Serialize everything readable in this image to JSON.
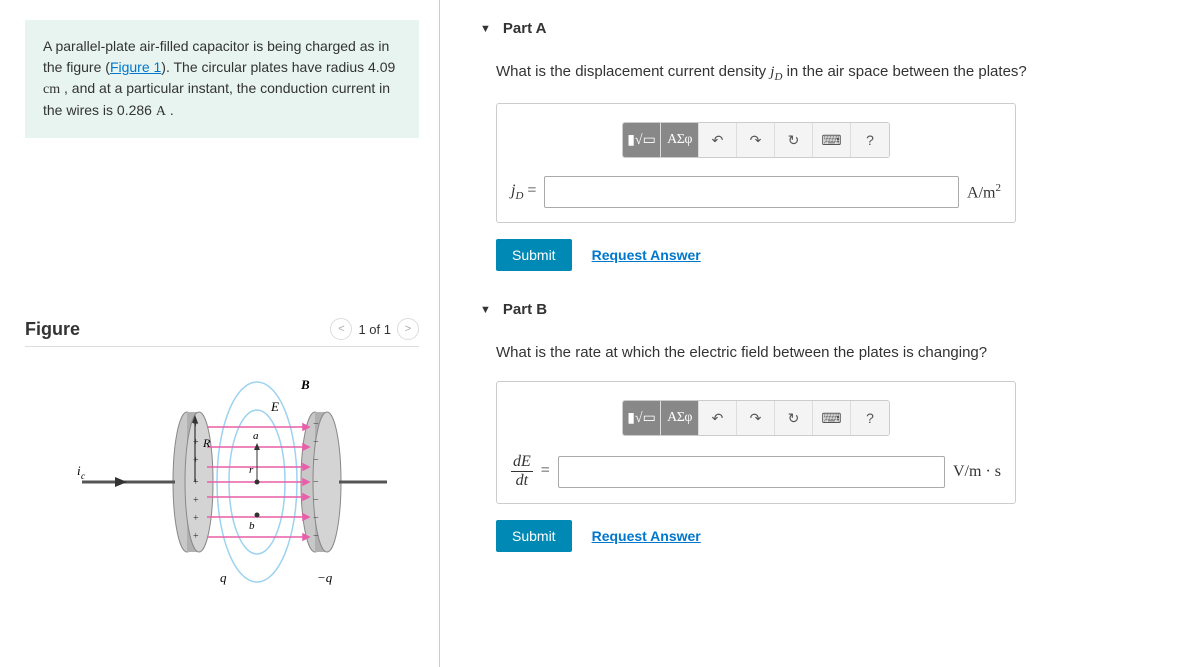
{
  "problem": {
    "text1": "A parallel-plate air-filled capacitor is being charged as in the figure (",
    "figlink": "Figure 1",
    "text2": "). The circular plates have radius 4.09 ",
    "unit_r": "cm",
    "text3": " , and at a particular instant, the conduction current in the wires is 0.286 ",
    "unit_i": "A",
    "text4": " ."
  },
  "figure": {
    "title": "Figure",
    "nav": "1 of 1"
  },
  "partA": {
    "title": "Part A",
    "question1": "What is the displacement current density ",
    "var": "j",
    "varSub": "D",
    "question2": " in the air space between the plates?",
    "varLabelEq": "=",
    "unit": "A/m",
    "unitSup": "2",
    "submit": "Submit",
    "request": "Request Answer"
  },
  "partB": {
    "title": "Part B",
    "question": "What is the rate at which the electric field between the plates is changing?",
    "fracNum": "dE",
    "fracDen": "dt",
    "eq": "=",
    "unit": "V/m · s",
    "submit": "Submit",
    "request": "Request Answer"
  },
  "tools": {
    "template": "▮√▭",
    "greek": "ΑΣφ",
    "undo": "↶",
    "redo": "↷",
    "reset": "↻",
    "keyboard": "⌨",
    "help": "?"
  }
}
